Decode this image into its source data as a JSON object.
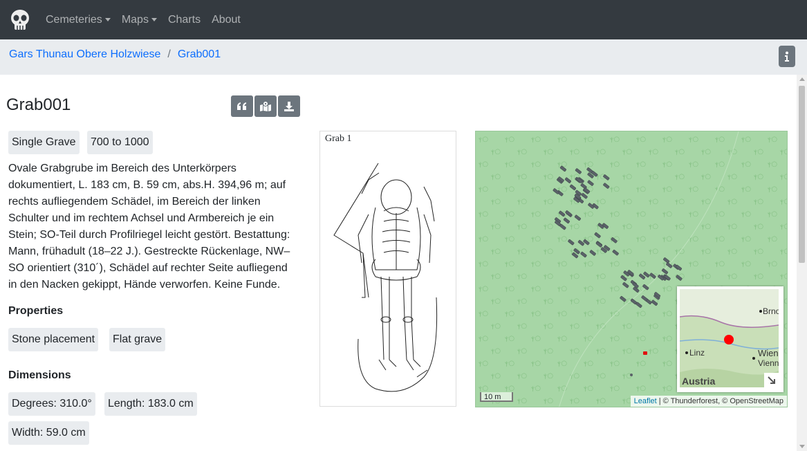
{
  "nav": {
    "items": [
      {
        "label": "Cemeteries",
        "dropdown": true
      },
      {
        "label": "Maps",
        "dropdown": true
      },
      {
        "label": "Charts",
        "dropdown": false
      },
      {
        "label": "About",
        "dropdown": false
      }
    ]
  },
  "breadcrumb": {
    "items": [
      "Gars Thunau Obere Holzwiese",
      "Grab001"
    ]
  },
  "page": {
    "title": "Grab001",
    "badges": [
      "Single Grave",
      "700 to 1000"
    ],
    "description": "Ovale Grabgrube im Bereich des Unterkörpers dokumentiert, L. 183 cm, B. 59 cm, abs.H. 394,96 m; auf rechts aufliegendem Schädel, im Bereich der linken Schulter und im rechtem Achsel und Armbereich je ein Stein; SO-Teil durch Profilriegel leicht gestört. Bestattung: Mann, frühadult (18–22 J.). Gestreckte Rückenlage, NW–SO orientiert (310´), Schädel auf rechter Seite aufliegend in den Nacken gekippt, Hände verworfen. Keine Funde.",
    "properties_heading": "Properties",
    "properties": [
      "Stone placement",
      "Flat grave"
    ],
    "dimensions_heading": "Dimensions",
    "dimensions": [
      "Degrees: 310.0°",
      "Length: 183.0 cm",
      "Width: 59.0 cm"
    ]
  },
  "drawing": {
    "caption": "Grab 1"
  },
  "map": {
    "scale": "10 m",
    "attribution_leaflet": "Leaflet",
    "attribution_rest": " | © Thunderforest, © OpenStreetMap",
    "minimap": {
      "country": "Austria",
      "cities": [
        "Brno",
        "Linz",
        "Wien",
        "Vienna"
      ]
    }
  },
  "colors": {
    "navbar": "#343a40",
    "link": "#0d6efd",
    "badge": "#e9ecef",
    "map_green": "#a7d6a6",
    "grave": "#5a6268",
    "highlight": "#e01010"
  }
}
